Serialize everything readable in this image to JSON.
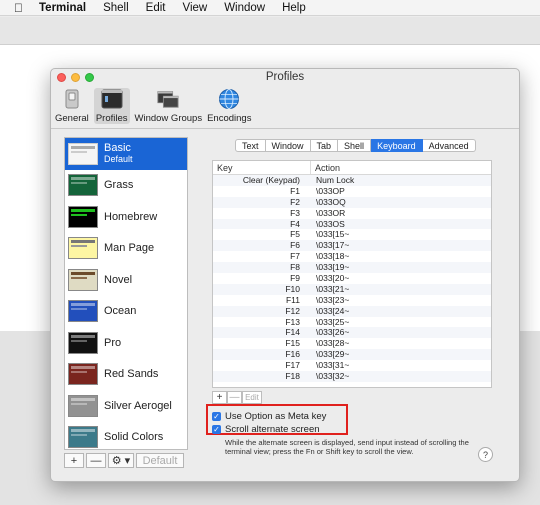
{
  "menubar": {
    "apple": "",
    "items": [
      "Terminal",
      "Shell",
      "Edit",
      "View",
      "Window",
      "Help"
    ]
  },
  "window": {
    "title": "Profiles"
  },
  "toolbar": {
    "items": [
      {
        "label": "General",
        "icon": "switch-icon"
      },
      {
        "label": "Profiles",
        "icon": "terminal-icon",
        "selected": true
      },
      {
        "label": "Window Groups",
        "icon": "window-groups-icon"
      },
      {
        "label": "Encodings",
        "icon": "globe-icon"
      }
    ]
  },
  "profiles": {
    "items": [
      {
        "name": "Basic",
        "sub": "Default",
        "thumb": "#f5f5f5",
        "selected": true
      },
      {
        "name": "Grass",
        "thumb": "#14643a"
      },
      {
        "name": "Homebrew",
        "thumb": "#000000"
      },
      {
        "name": "Man Page",
        "thumb": "#fdf6a3"
      },
      {
        "name": "Novel",
        "thumb": "#dfdbc3"
      },
      {
        "name": "Ocean",
        "thumb": "#224fbc"
      },
      {
        "name": "Pro",
        "thumb": "#111111"
      },
      {
        "name": "Red Sands",
        "thumb": "#7a251e"
      },
      {
        "name": "Silver Aerogel",
        "thumb": "#929292"
      },
      {
        "name": "Solid Colors",
        "thumb": "#3c7a8a"
      }
    ],
    "buttons": {
      "add": "+",
      "remove": "—",
      "gear": "⚙ ▾",
      "default": "Default"
    }
  },
  "tabs": {
    "items": [
      "Text",
      "Window",
      "Tab",
      "Shell",
      "Keyboard",
      "Advanced"
    ],
    "active": "Keyboard"
  },
  "keyboard": {
    "headers": {
      "key": "Key",
      "action": "Action"
    },
    "rows": [
      {
        "key": "Clear (Keypad)",
        "action": "Num Lock"
      },
      {
        "key": "F1",
        "action": "\\033OP"
      },
      {
        "key": "F2",
        "action": "\\033OQ"
      },
      {
        "key": "F3",
        "action": "\\033OR"
      },
      {
        "key": "F4",
        "action": "\\033OS"
      },
      {
        "key": "F5",
        "action": "\\033[15~"
      },
      {
        "key": "F6",
        "action": "\\033[17~"
      },
      {
        "key": "F7",
        "action": "\\033[18~"
      },
      {
        "key": "F8",
        "action": "\\033[19~"
      },
      {
        "key": "F9",
        "action": "\\033[20~"
      },
      {
        "key": "F10",
        "action": "\\033[21~"
      },
      {
        "key": "F11",
        "action": "\\033[23~"
      },
      {
        "key": "F12",
        "action": "\\033[24~"
      },
      {
        "key": "F13",
        "action": "\\033[25~"
      },
      {
        "key": "F14",
        "action": "\\033[26~"
      },
      {
        "key": "F15",
        "action": "\\033[28~"
      },
      {
        "key": "F16",
        "action": "\\033[29~"
      },
      {
        "key": "F17",
        "action": "\\033[31~"
      },
      {
        "key": "F18",
        "action": "\\033[32~"
      }
    ],
    "buttons": {
      "add": "+",
      "remove": "—",
      "edit": "Edit"
    }
  },
  "options": {
    "meta": {
      "label": "Use Option as Meta key",
      "checked": true
    },
    "alt_screen": {
      "label": "Scroll alternate screen",
      "checked": true
    },
    "description": "While the alternate screen is displayed, send input instead of scrolling the terminal view; press the Fn or Shift key to scroll the view.",
    "help": "?"
  },
  "colors": {
    "accent": "#2a76e5",
    "highlight": "#e0211d",
    "selection": "#1a65d5"
  }
}
